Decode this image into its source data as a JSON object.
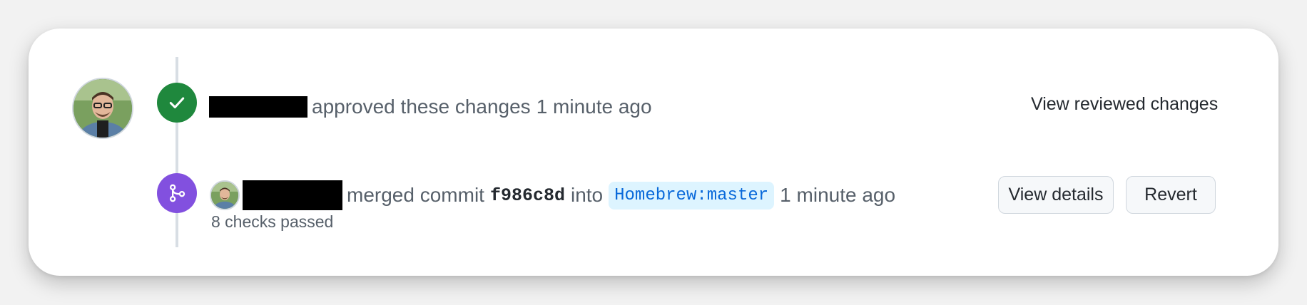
{
  "approval": {
    "action_text": "approved these changes",
    "time": "1 minute ago",
    "view_reviewed_label": "View reviewed changes"
  },
  "merge": {
    "prefix": "merged commit",
    "commit_sha": "f986c8d",
    "into": "into",
    "branch": "Homebrew:master",
    "time": "1 minute ago",
    "checks": "8 checks passed",
    "view_details_label": "View details",
    "revert_label": "Revert"
  },
  "colors": {
    "approved_badge": "#1f883d",
    "merged_badge": "#8250df",
    "branch_bg": "#ddf4ff",
    "branch_text": "#0969da"
  },
  "icons": {
    "approved": "check-icon",
    "merged": "git-merge-icon"
  }
}
